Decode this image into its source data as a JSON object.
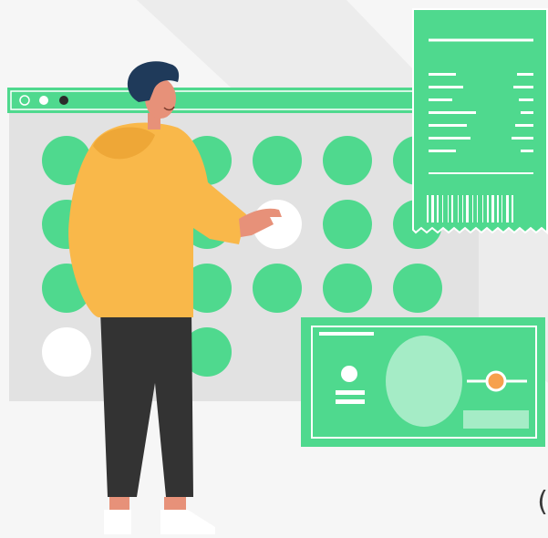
{
  "scene": {
    "title": "",
    "colors": {
      "background": "#f6f6f6",
      "panel": "#e2e2e2",
      "accent": "#4fd98e",
      "accent_dark": "#3fbf7b",
      "accent_light": "#a5ecc6",
      "hoodie": "#f9b84a",
      "pants": "#333333",
      "hair": "#1f3a5a",
      "skin": "#e79179",
      "coin": "#f6a04d"
    },
    "window": {
      "controls": [
        "empty-dot",
        "white-dot",
        "dark-dot"
      ],
      "grid": [
        [
          "green",
          "green",
          "green",
          "green",
          "green",
          "green"
        ],
        [
          "green",
          "green",
          "green",
          "white",
          "green",
          "green"
        ],
        [
          "green",
          "green",
          "green",
          "green",
          "green",
          "green"
        ],
        [
          "white",
          "green",
          "green",
          "none",
          "none",
          "none"
        ]
      ]
    },
    "receipt": {
      "line_count": 7,
      "barcode": true
    },
    "banknote": {
      "has_portrait_icon": true,
      "has_coin_slider": true
    },
    "trailing_glyph": "("
  }
}
